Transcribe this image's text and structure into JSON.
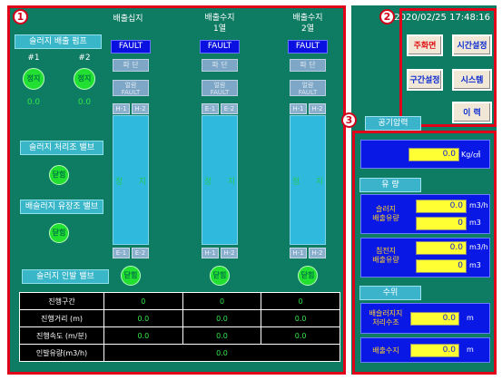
{
  "header": {
    "col1": "배출십지",
    "col2_l1": "배출수지",
    "col2_l2": "1열",
    "col3_l1": "배출수지",
    "col3_l2": "2열",
    "datetime": "2020/02/25 17:48:16"
  },
  "badges": [
    "1",
    "2",
    "3"
  ],
  "left": {
    "pump_title": "슬러지 배출 펌프",
    "pump1_tag": "#1",
    "pump2_tag": "#2",
    "pump1_state": "정지",
    "pump2_state": "정지",
    "pump1_value": "0.0",
    "pump2_value": "0.0",
    "treat_valve_title": "슬러지 처리조 밸브",
    "treat_valve_state": "닫힘",
    "drain_valve_title": "배슬러지 유장조 밸브",
    "drain_valve_state": "닫힘",
    "lead_valve_title": "슬러지 인발 밸브"
  },
  "columns": [
    {
      "fault": "FAULT",
      "btn1": "파 단",
      "btn2": "얼람\nFAULT",
      "limit_l": "H-1",
      "limit_r": "H-2",
      "tank_left": "정",
      "tank_right": "지",
      "bottom_l": "E-1",
      "bottom_r": "E-2",
      "valve": "닫힘"
    },
    {
      "fault": "FAULT",
      "btn1": "파 단",
      "btn2": "얼람\nFAULT",
      "limit_l": "E-1",
      "limit_r": "E-2",
      "tank_left": "정",
      "tank_right": "지",
      "bottom_l": "H-1",
      "bottom_r": "H-2",
      "valve": "닫힘"
    },
    {
      "fault": "FAULT",
      "btn1": "파 단",
      "btn2": "얼람\nFAULT",
      "limit_l": "H-1",
      "limit_r": "H-2",
      "tank_left": "정",
      "tank_right": "지",
      "bottom_l": "H-1",
      "bottom_r": "H-2",
      "valve": "닫힘"
    }
  ],
  "table": {
    "rows": [
      {
        "label": "진행구간",
        "v1": "0",
        "v2": "0",
        "v3": "0"
      },
      {
        "label": "진행거리 (m)",
        "v1": "0.0",
        "v2": "0.0",
        "v3": "0.0"
      },
      {
        "label": "진행속도 (m/분)",
        "v1": "0.0",
        "v2": "0.0",
        "v3": "0.0"
      }
    ],
    "total_label": "인발유량(m3/h)",
    "total_value": "0.0"
  },
  "menu": {
    "main": "주화면",
    "time": "시간설정",
    "section": "구간설정",
    "system": "시스템",
    "history": "이 력"
  },
  "right": {
    "air_title": "공기압력",
    "air_value": "0.0",
    "air_unit": "Kg/㎠",
    "flow_title": "유 량",
    "sludge_flow_label": "슬러지\n배출유량",
    "sludge_rate": "0.0",
    "sludge_rate_unit": "m3/h",
    "sludge_total": "0",
    "sludge_total_unit": "m3",
    "settle_flow_label": "침전지\n배출유량",
    "settle_rate": "0.0",
    "settle_rate_unit": "m3/h",
    "settle_total": "0",
    "settle_total_unit": "m3",
    "level_title": "수위",
    "level1_label": "배슬러지지\n처리수조",
    "level1_value": "0.0",
    "level1_unit": "m",
    "level2_label": "배출수지",
    "level2_value": "0.0",
    "level2_unit": "m"
  },
  "colors": {
    "panel": "#0e7b63",
    "fault": "#0a10e0",
    "tank": "#2fb9dd",
    "valve": "#21e032",
    "frame": "#e0001a"
  }
}
